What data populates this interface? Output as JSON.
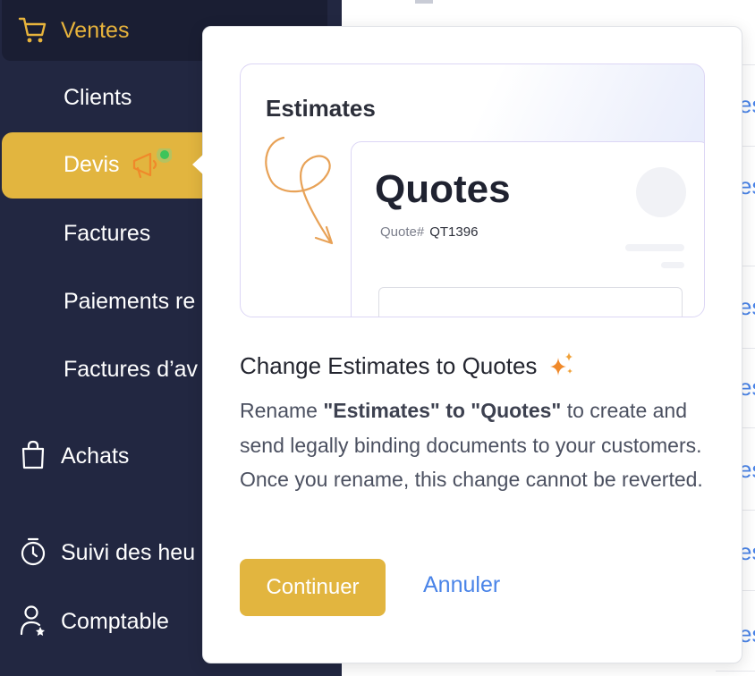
{
  "sidebar": {
    "top_item": {
      "label": "Ventes",
      "icon": "shopping-cart-icon",
      "color": "#e8b43c"
    },
    "sub_items": [
      {
        "label": "Clients",
        "active": false
      },
      {
        "label": "Devis",
        "active": true
      },
      {
        "label": "Factures",
        "active": false
      },
      {
        "label": "Paiements re",
        "active": false
      },
      {
        "label": "Factures d’av",
        "active": false
      }
    ],
    "sections": [
      {
        "label": "Achats",
        "icon": "shopping-bag-icon"
      },
      {
        "label": "Suivi des heu",
        "icon": "stopwatch-icon"
      },
      {
        "label": "Comptable",
        "icon": "user-badge-icon"
      }
    ],
    "active_icon": "megaphone-icon",
    "active_color": "#e2b53f",
    "background": "#222741"
  },
  "background_list": {
    "row_fragment": "es"
  },
  "modal": {
    "illustration": {
      "heading": "Estimates",
      "card_title": "Quotes",
      "quote_label": "Quote#",
      "quote_number": "QT1396"
    },
    "title": "Change Estimates to Quotes",
    "title_icon": "sparkle-icon",
    "body": {
      "prefix": "Rename ",
      "bold": "\"Estimates\" to \"Quotes\"",
      "suffix": " to create and send legally binding documents to your customers. Once you rename, this change cannot be reverted."
    },
    "continue_label": "Continuer",
    "cancel_label": "Annuler",
    "accent": "#e2b53f",
    "link_color": "#4a84e8"
  }
}
